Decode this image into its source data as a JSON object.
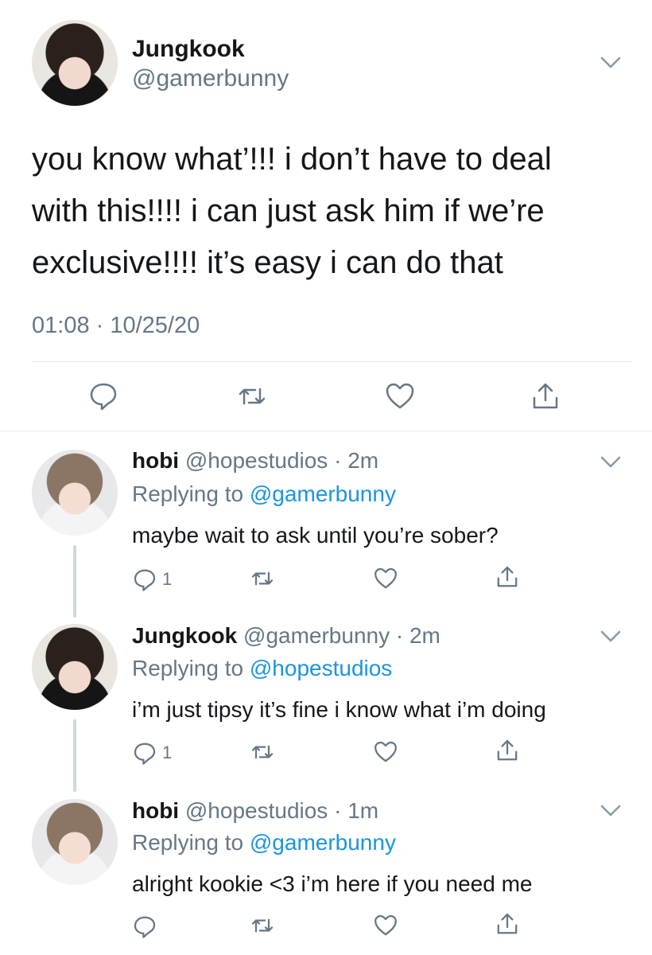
{
  "main_tweet": {
    "display_name": "Jungkook",
    "handle": "@gamerbunny",
    "text_line1": "you know what’!!! i don’t have to deal",
    "text_line2": "with this!!!! i can just ask him if we’re",
    "text_line3": "exclusive!!!! it’s easy i can do that",
    "timestamp": "01:08 · 10/25/20",
    "icons": [
      "reply-icon",
      "retweet-icon",
      "like-icon",
      "share-icon"
    ]
  },
  "replies": [
    {
      "display_name": "hobi",
      "handle": "@hopestudios",
      "time": "· 2m",
      "replying_prefix": "Replying to ",
      "replying_to": "@gamerbunny",
      "text": "maybe wait to ask until you’re sober?",
      "reply_count": "1"
    },
    {
      "display_name": "Jungkook",
      "handle": "@gamerbunny",
      "time": "· 2m",
      "replying_prefix": "Replying to ",
      "replying_to": "@hopestudios",
      "text": "i’m just tipsy it’s fine i know what i’m doing",
      "reply_count": "1"
    },
    {
      "display_name": "hobi",
      "handle": "@hopestudios",
      "time": "· 1m",
      "replying_prefix": "Replying to ",
      "replying_to": "@gamerbunny",
      "text": "alright kookie <3 i’m here if you need me",
      "reply_count": ""
    }
  ],
  "colors": {
    "text": "#14171a",
    "muted": "#657786",
    "link": "#1b95e0",
    "divider": "#e6ecf0"
  }
}
